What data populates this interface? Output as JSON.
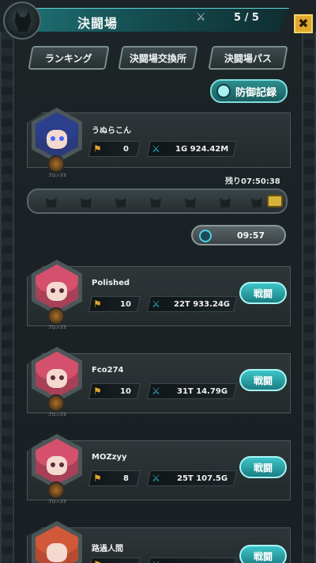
{
  "header": {
    "title": "決闘場",
    "counter": "5 / 5",
    "close": "✖"
  },
  "nav": {
    "ranking": "ランキング",
    "exchange": "決闘場交換所",
    "pass": "決闘場パス"
  },
  "defense_record": "防御記録",
  "player": {
    "name": "うぬらこん",
    "rank_value": "0",
    "power": "1G 924.42M",
    "rank_label": "ブロンズ3"
  },
  "remaining": "残り07:50:38",
  "timer": "09:57",
  "opponents": [
    {
      "name": "Polished",
      "rank_value": "10",
      "power": "22T 933.24G",
      "battle": "戦闘",
      "rank_label": "ブロンズ3"
    },
    {
      "name": "Fco274",
      "rank_value": "10",
      "power": "31T 14.79G",
      "battle": "戦闘",
      "rank_label": "ブロンズ3"
    },
    {
      "name": "MOZzyy",
      "rank_value": "8",
      "power": "25T 107.5G",
      "battle": "戦闘",
      "rank_label": "ブロンズ3"
    },
    {
      "name": "路過人間",
      "rank_value": "",
      "power": "",
      "battle": "戦闘",
      "rank_label": ""
    }
  ],
  "colors": {
    "accent": "#2aa6aa",
    "gold": "#e1a430",
    "blue_stat": "#2ab9d1"
  }
}
